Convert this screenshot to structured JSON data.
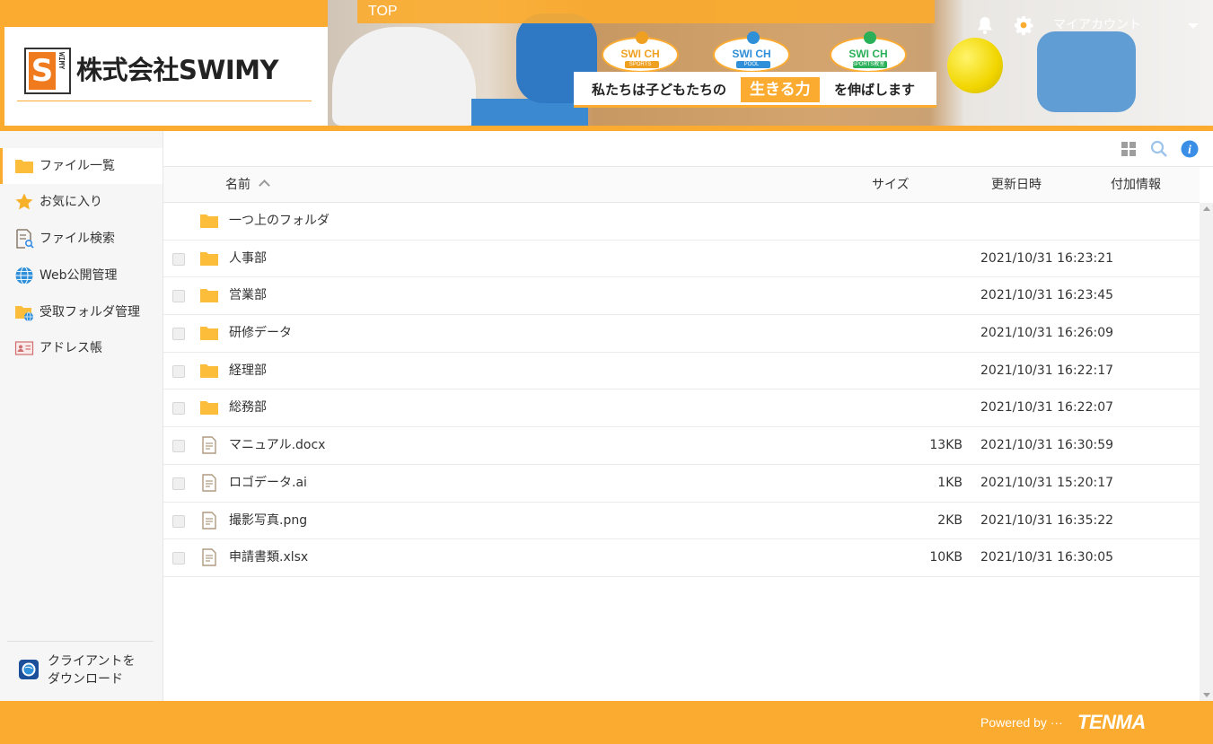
{
  "header": {
    "company_name": "株式会社SWIMY",
    "logo_letter": "S",
    "logo_vertical": "WIMY",
    "breadcrumb": "TOP",
    "badges": [
      {
        "main": "SWI CH",
        "sub": "SPORTS",
        "color": "#f0a020"
      },
      {
        "main": "SWI CH",
        "sub": "POOL",
        "color": "#2f8fd8"
      },
      {
        "main": "SWI CH",
        "sub": "SPORTS教室",
        "color": "#2bb05a"
      }
    ],
    "tagline_pre": "私たちは子どもたちの",
    "tagline_highlight": "生きる力",
    "tagline_post": "を伸ばします",
    "account_label": "マイアカウント"
  },
  "sidebar": {
    "items": [
      {
        "label": "ファイル一覧",
        "icon": "folder-icon",
        "active": true
      },
      {
        "label": "お気に入り",
        "icon": "star-icon",
        "active": false
      },
      {
        "label": "ファイル検索",
        "icon": "file-search-icon",
        "active": false
      },
      {
        "label": "Web公開管理",
        "icon": "globe-icon",
        "active": false
      },
      {
        "label": "受取フォルダ管理",
        "icon": "receive-folder-icon",
        "active": false
      },
      {
        "label": "アドレス帳",
        "icon": "address-book-icon",
        "active": false
      }
    ],
    "download_client": "クライアントを\nダウンロード"
  },
  "table": {
    "headers": {
      "name": "名前",
      "size": "サイズ",
      "updated": "更新日時",
      "extra": "付加情報"
    },
    "rows": [
      {
        "type": "parent",
        "name": "一つ上のフォルダ",
        "size": "",
        "updated": ""
      },
      {
        "type": "folder",
        "name": "人事部",
        "size": "",
        "updated": "2021/10/31 16:23:21"
      },
      {
        "type": "folder",
        "name": "営業部",
        "size": "",
        "updated": "2021/10/31 16:23:45"
      },
      {
        "type": "folder",
        "name": "研修データ",
        "size": "",
        "updated": "2021/10/31 16:26:09"
      },
      {
        "type": "folder",
        "name": "経理部",
        "size": "",
        "updated": "2021/10/31 16:22:17"
      },
      {
        "type": "folder",
        "name": "総務部",
        "size": "",
        "updated": "2021/10/31 16:22:07"
      },
      {
        "type": "file",
        "name": "マニュアル.docx",
        "size": "13KB",
        "updated": "2021/10/31 16:30:59"
      },
      {
        "type": "file",
        "name": "ロゴデータ.ai",
        "size": "1KB",
        "updated": "2021/10/31 15:20:17"
      },
      {
        "type": "file",
        "name": "撮影写真.png",
        "size": "2KB",
        "updated": "2021/10/31 16:35:22"
      },
      {
        "type": "file",
        "name": "申請書類.xlsx",
        "size": "10KB",
        "updated": "2021/10/31 16:30:05"
      }
    ]
  },
  "footer": {
    "powered_by": "Powered by ···",
    "brand": "TENMA"
  },
  "colors": {
    "accent": "#fbab2f",
    "folder": "#fbbd3a",
    "info": "#3a8ee6"
  }
}
